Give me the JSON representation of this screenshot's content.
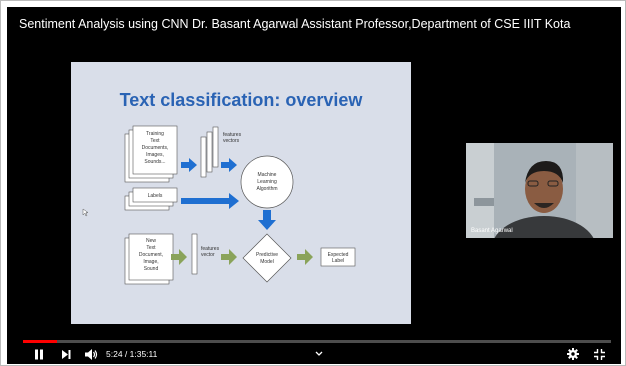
{
  "video": {
    "title": "Sentiment Analysis using CNN Dr. Basant Agarwal Assistant Professor,Department of CSE IIIT Kota"
  },
  "slide": {
    "heading": "Text classification:  overview",
    "labels": {
      "training": [
        "Training",
        "Text",
        "Documents,",
        "Images,",
        "Sounds..."
      ],
      "features_top": [
        "features",
        "vectors"
      ],
      "ml_algorithm": [
        "Machine",
        "Learning",
        "Algorithm"
      ],
      "labels_box": "Labels",
      "new_doc": [
        "New",
        "Text",
        "Document,",
        "Image,",
        "Sound"
      ],
      "features_bottom": [
        "features",
        "vector"
      ],
      "predictive_model": [
        "Predictive",
        "Model"
      ],
      "expected_label": [
        "Expected",
        "Label"
      ]
    },
    "colors": {
      "heading": "#2a63b4",
      "arrow_blue": "#1f6fd1",
      "arrow_green": "#8aa35a"
    }
  },
  "webcam": {
    "name": "Basant Agarwal"
  },
  "player": {
    "time_display": "5:24 / 1:35:11",
    "progress_fraction": 0.057,
    "icons": {
      "play_pause": "pause-icon",
      "next": "next-icon",
      "volume": "volume-icon",
      "chapters": "chevron-down-icon",
      "settings": "gear-icon",
      "exit_fullscreen": "exit-fullscreen-icon"
    },
    "accent": "#ff0000"
  }
}
